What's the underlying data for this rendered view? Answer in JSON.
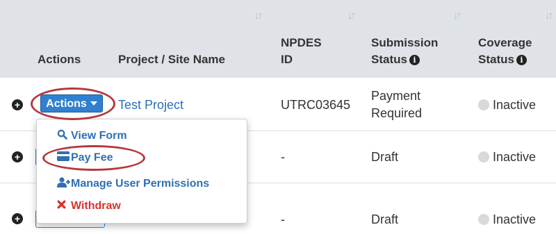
{
  "table": {
    "columns": [
      {
        "label": "Actions",
        "sortable": false
      },
      {
        "label": "Project / Site Name",
        "sortable": true
      },
      {
        "label": "NPDES ID",
        "line1": "NPDES",
        "line2": "ID",
        "sortable": true
      },
      {
        "label": "Submission Status",
        "line1": "Submission",
        "line2": "Status",
        "info": true,
        "sortable": true
      },
      {
        "label": "Coverage Status",
        "line1": "Coverage",
        "line2": "Status",
        "info": true,
        "sortable": true
      }
    ],
    "sort_icon": "↓↑",
    "info_icon": "i",
    "rows": [
      {
        "project": "Test Project",
        "npdes_id": "UTRC03645",
        "submission_status_line1": "Payment",
        "submission_status_line2": "Required",
        "coverage_status": "Inactive"
      },
      {
        "project": "",
        "npdes_id": "-",
        "submission_status": "Draft",
        "coverage_status": "Inactive"
      },
      {
        "project": "",
        "npdes_id": "-",
        "submission_status": "Draft",
        "coverage_status": "Inactive"
      }
    ]
  },
  "actions_button": {
    "label": "Actions"
  },
  "dropdown": {
    "items": [
      {
        "label": "View Form",
        "icon": "search-icon"
      },
      {
        "label": "Pay Fee",
        "icon": "credit-card-icon"
      },
      {
        "label": "Manage User Permissions",
        "icon": "user-plus-icon"
      },
      {
        "label": "Withdraw",
        "icon": "close-icon"
      }
    ]
  },
  "colors": {
    "header_bg": "#dfe3e7",
    "primary": "#2f80d0",
    "link": "#2a6fbb",
    "danger": "#d9312f",
    "highlight": "#b5383c"
  }
}
